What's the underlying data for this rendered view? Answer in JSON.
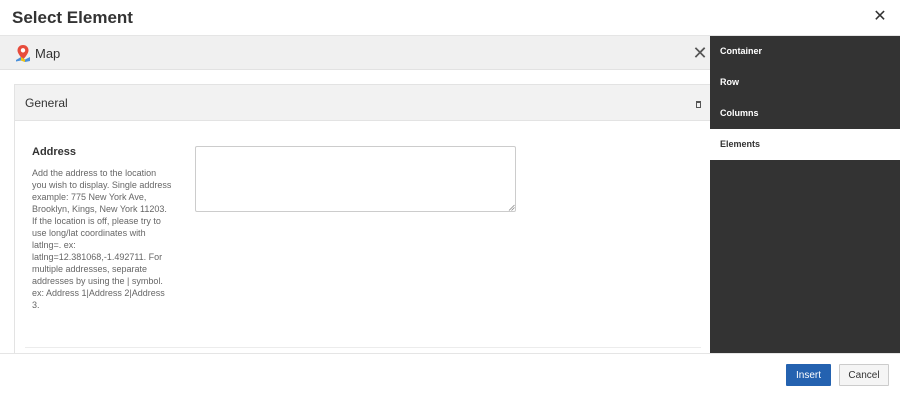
{
  "dialog": {
    "title": "Select Element",
    "close_icon": "close-icon"
  },
  "element_bar": {
    "label": "Map",
    "icon": "map-pin-icon",
    "remove_icon": "close-icon"
  },
  "panel": {
    "title": "General",
    "toggle_icon": "collapse-icon",
    "field": {
      "label": "Address",
      "help": "Add the address to the location you wish to display. Single address example: 775 New York Ave, Brooklyn, Kings, New York 11203. If the location is off, please try to use long/lat coordinates with latlng=. ex: latlng=12.381068,-1.492711. For multiple addresses, separate addresses by using the | symbol. ex: Address 1|Address 2|Address 3.",
      "value": "",
      "placeholder": ""
    }
  },
  "sidebar": {
    "items": [
      {
        "label": "Container",
        "active": false
      },
      {
        "label": "Row",
        "active": false
      },
      {
        "label": "Columns",
        "active": false
      },
      {
        "label": "Elements",
        "active": true
      }
    ]
  },
  "footer": {
    "insert_label": "Insert",
    "cancel_label": "Cancel"
  },
  "colors": {
    "primary": "#2462b0",
    "sidebar_bg": "#333333",
    "bar_bg": "#f0f0f0"
  }
}
